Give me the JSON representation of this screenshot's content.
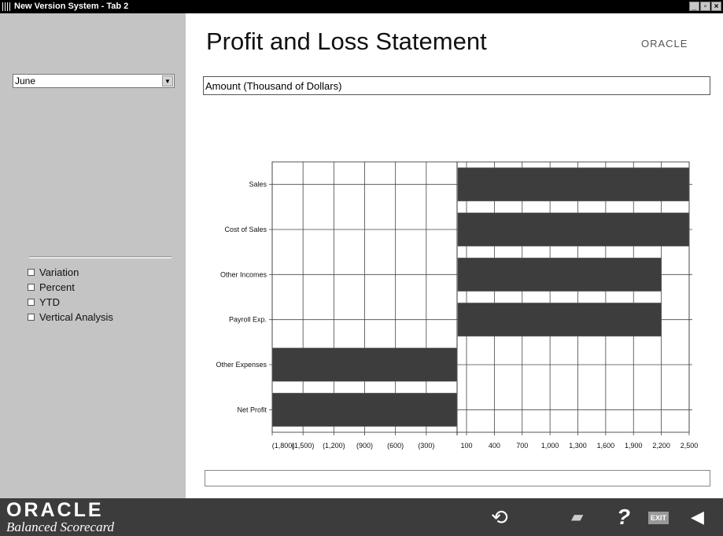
{
  "window": {
    "title": "New Version System - Tab 2",
    "min": "_",
    "max": "▫",
    "close": "×"
  },
  "sidebar": {
    "month_select": "June",
    "checkboxes": [
      "Variation",
      "Percent",
      "YTD",
      "Vertical Analysis"
    ]
  },
  "header": {
    "title": "Profit and Loss Statement",
    "brand": "ORACLE"
  },
  "chart_header": "Amount (Thousand of Dollars)",
  "chart_data": {
    "type": "bar",
    "orientation": "horizontal",
    "categories": [
      "Sales",
      "Cost of Sales",
      "Other Incomes",
      "Payroll Exp.",
      "Other Expenses",
      "Net Profit"
    ],
    "series": [
      {
        "values": [
          2500,
          2500,
          2200,
          2200,
          -1800,
          -1800
        ]
      }
    ],
    "x_negative_ticks": [
      "(1,800)",
      "(1,500)",
      "(1,200)",
      "(900)",
      "(600)",
      "(300)"
    ],
    "x_positive_ticks": [
      "100",
      "400",
      "700",
      "1,000",
      "1,300",
      "1,600",
      "1,900",
      "2,200",
      "2,500"
    ],
    "grid": true,
    "bar_color": "#3d3d3d"
  },
  "footer": {
    "logo": "ORACLE",
    "logo_sub": "Balanced Scorecard",
    "tools": [
      {
        "icon": "refresh-icon",
        "glyph": "⟲"
      },
      {
        "icon": "print-icon",
        "glyph": "▰"
      },
      {
        "icon": "help-icon",
        "glyph": "?"
      },
      {
        "icon": "exit-icon",
        "glyph": "EXIT"
      },
      {
        "icon": "back-arrow-icon",
        "glyph": "◀"
      }
    ]
  }
}
